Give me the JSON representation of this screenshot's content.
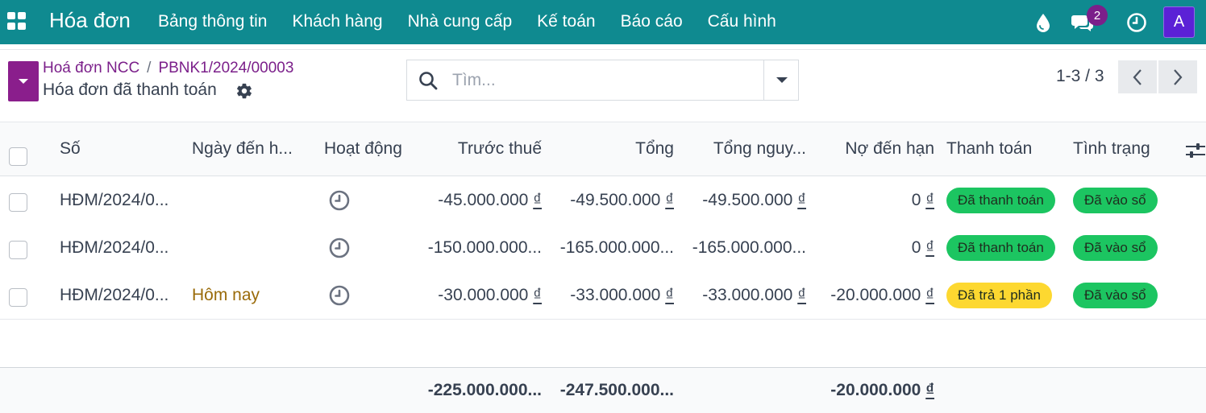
{
  "navbar": {
    "brand": "Hóa đơn",
    "menu": [
      "Bảng thông tin",
      "Khách hàng",
      "Nhà cung cấp",
      "Kế toán",
      "Báo cáo",
      "Cấu hình"
    ],
    "chat_badge": "2",
    "avatar_letter": "A",
    "icons": [
      "apps-grid-icon",
      "droplet-icon",
      "chat-bubbles-icon",
      "clock-icon"
    ]
  },
  "breadcrumb": {
    "items": [
      "Hoá đơn NCC",
      "PBNK1/2024/00003"
    ],
    "separator": "/",
    "title": "Hóa đơn đã thanh toán"
  },
  "search": {
    "placeholder": "Tìm..."
  },
  "pager": {
    "value": "1-3 / 3"
  },
  "table": {
    "headers": {
      "number": "Số",
      "due_date": "Ngày đến h...",
      "activity": "Hoạt động",
      "untaxed": "Trước thuế",
      "total": "Tổng",
      "total_currency": "Tổng nguy...",
      "amount_due": "Nợ đến hạn",
      "payment": "Thanh toán",
      "status": "Tình trạng"
    },
    "rows": [
      {
        "number": "HĐM/2024/0...",
        "due_date": "",
        "untaxed": "-45.000.000",
        "total": "-49.500.000",
        "total_currency": "-49.500.000",
        "amount_due": "0",
        "payment": "Đã thanh toán",
        "payment_color": "#1cc561",
        "status": "Đã vào sổ"
      },
      {
        "number": "HĐM/2024/0...",
        "due_date": "",
        "untaxed": "-150.000.000...",
        "total": "-165.000.000...",
        "total_currency": "-165.000.000...",
        "amount_due": "0",
        "payment": "Đã thanh toán",
        "payment_color": "#1cc561",
        "status": "Đã vào sổ"
      },
      {
        "number": "HĐM/2024/0...",
        "due_date": "Hôm nay",
        "untaxed": "-30.000.000",
        "total": "-33.000.000",
        "total_currency": "-33.000.000",
        "amount_due": "-20.000.000",
        "payment": "Đã trả 1 phần",
        "payment_color": "#fdd830",
        "status": "Đã vào sổ"
      }
    ],
    "currency_symbol": "₫",
    "footer": {
      "untaxed": "-225.000.000...",
      "total": "-247.500.000...",
      "amount_due": "-20.000.000"
    }
  },
  "colors": {
    "navbar": "#0f8a90",
    "accent": "#7b1f8a",
    "avatar": "#5b21d6",
    "paid": "#1cc561",
    "partial": "#fdd830"
  }
}
